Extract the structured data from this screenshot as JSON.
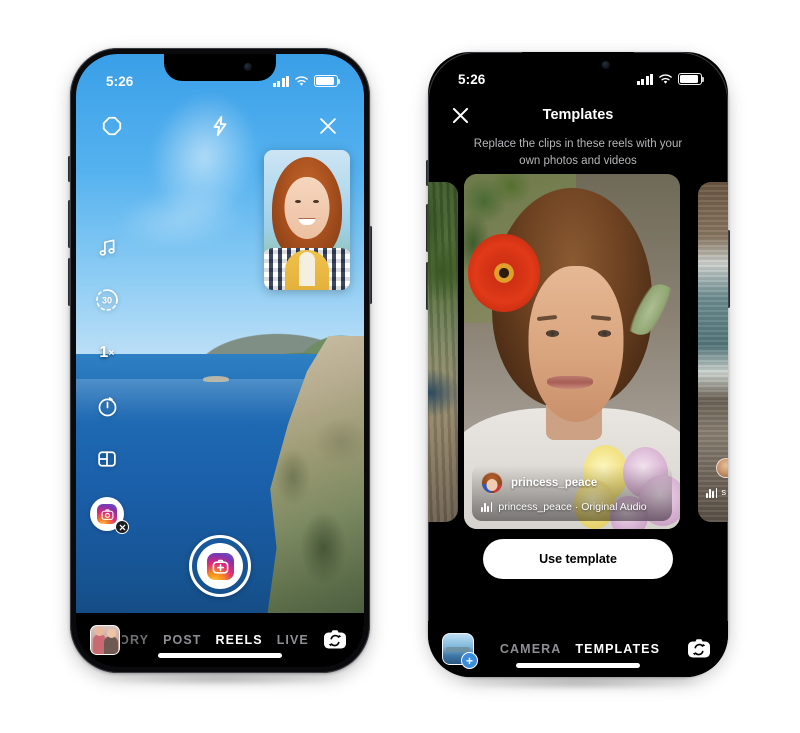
{
  "page": {
    "background_color": "#ffffff",
    "description": "Two iPhone mockups side by side showing Instagram Reels camera and Templates screens"
  },
  "left_phone": {
    "status_bar": {
      "time": "5:26",
      "signal_icon": "cellular-bars-icon",
      "wifi_icon": "wifi-icon",
      "battery_icon": "battery-icon"
    },
    "top_controls": [
      {
        "name": "effects-icon",
        "glyph": "octagon-outline"
      },
      {
        "name": "flash-icon",
        "glyph": "lightning-bolt"
      },
      {
        "name": "close-icon",
        "glyph": "x-mark"
      }
    ],
    "tool_rail": [
      {
        "name": "audio-icon",
        "label": "",
        "glyph": "music-note"
      },
      {
        "name": "duration-icon",
        "label": "30",
        "glyph": "timer-ring"
      },
      {
        "name": "speed-icon",
        "label": "1",
        "suffix": "×",
        "glyph": "speed-text"
      },
      {
        "name": "timer-icon",
        "label": "",
        "glyph": "stopwatch"
      },
      {
        "name": "layout-icon",
        "label": "",
        "glyph": "grid-panels"
      },
      {
        "name": "effect-chip",
        "label": "",
        "glyph": "instagram-camera",
        "selected": true,
        "remove_badge": "×"
      }
    ],
    "pip_label": "selfie-preview",
    "shutter": {
      "name": "record-button",
      "glyph": "instagram-camera-plus"
    },
    "bottom_bar": {
      "gallery_thumb": "gallery-thumbnail",
      "modes": [
        {
          "label": "ORY",
          "active": false,
          "clipped": true
        },
        {
          "label": "POST",
          "active": false,
          "clipped": false
        },
        {
          "label": "REELS",
          "active": true,
          "clipped": false
        },
        {
          "label": "LIVE",
          "active": false,
          "clipped": false
        }
      ],
      "flip_camera": "flip-camera-icon"
    }
  },
  "right_phone": {
    "status_bar": {
      "time": "5:26",
      "signal_icon": "cellular-bars-icon",
      "wifi_icon": "wifi-icon",
      "battery_icon": "battery-icon"
    },
    "header": {
      "close_label": "✕",
      "title": "Templates"
    },
    "subtitle": "Replace the clips in these reels with your own photos and videos",
    "carousel": {
      "left_card": {
        "name": "template-card-previous",
        "artwork": "green-path-scene"
      },
      "center_card": {
        "name": "template-card-current",
        "artwork": "portrait-with-flowers",
        "username": "princess_peace",
        "audio": "princess_peace · Original Audio",
        "audio_icon": "audio-waveform-icon"
      },
      "right_card": {
        "name": "template-card-next",
        "artwork": "beach-shore-scene",
        "audio_partial": "s"
      }
    },
    "use_template_button": "Use template",
    "bottom_bar": {
      "photo_add": "add-photo-icon",
      "plus_badge": "+",
      "modes": [
        {
          "label": "CAMERA",
          "active": false
        },
        {
          "label": "TEMPLATES",
          "active": true
        }
      ],
      "flip_camera": "flip-camera-icon"
    }
  }
}
